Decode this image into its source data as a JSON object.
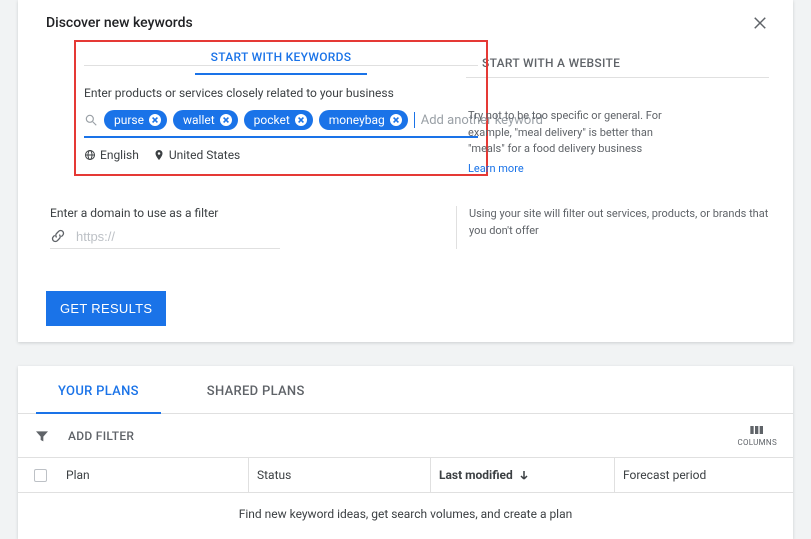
{
  "header": {
    "title": "Discover new keywords"
  },
  "tabs": {
    "keywords": "START WITH KEYWORDS",
    "website": "START WITH A WEBSITE"
  },
  "instruction": "Enter products or services closely related to your business",
  "chips": [
    "purse",
    "wallet",
    "pocket",
    "moneybag"
  ],
  "add_keyword_placeholder": "Add another keyword",
  "lang_label": "English",
  "loc_label": "United States",
  "hint1": "Try not to be too specific or general. For example, \"meal delivery\" is better than \"meals\" for a food delivery business",
  "learn_more": "Learn more",
  "domain": {
    "label": "Enter a domain to use as a filter",
    "placeholder": "https://"
  },
  "hint2": "Using your site will filter out services, products, or brands that you don't offer",
  "get_results": "GET RESULTS",
  "plans": {
    "tab_your": "YOUR PLANS",
    "tab_shared": "SHARED PLANS",
    "add_filter": "ADD FILTER",
    "columns_label": "COLUMNS",
    "col_plan": "Plan",
    "col_status": "Status",
    "col_modified": "Last modified",
    "col_forecast": "Forecast period",
    "empty": "Find new keyword ideas, get search volumes, and create a plan"
  }
}
